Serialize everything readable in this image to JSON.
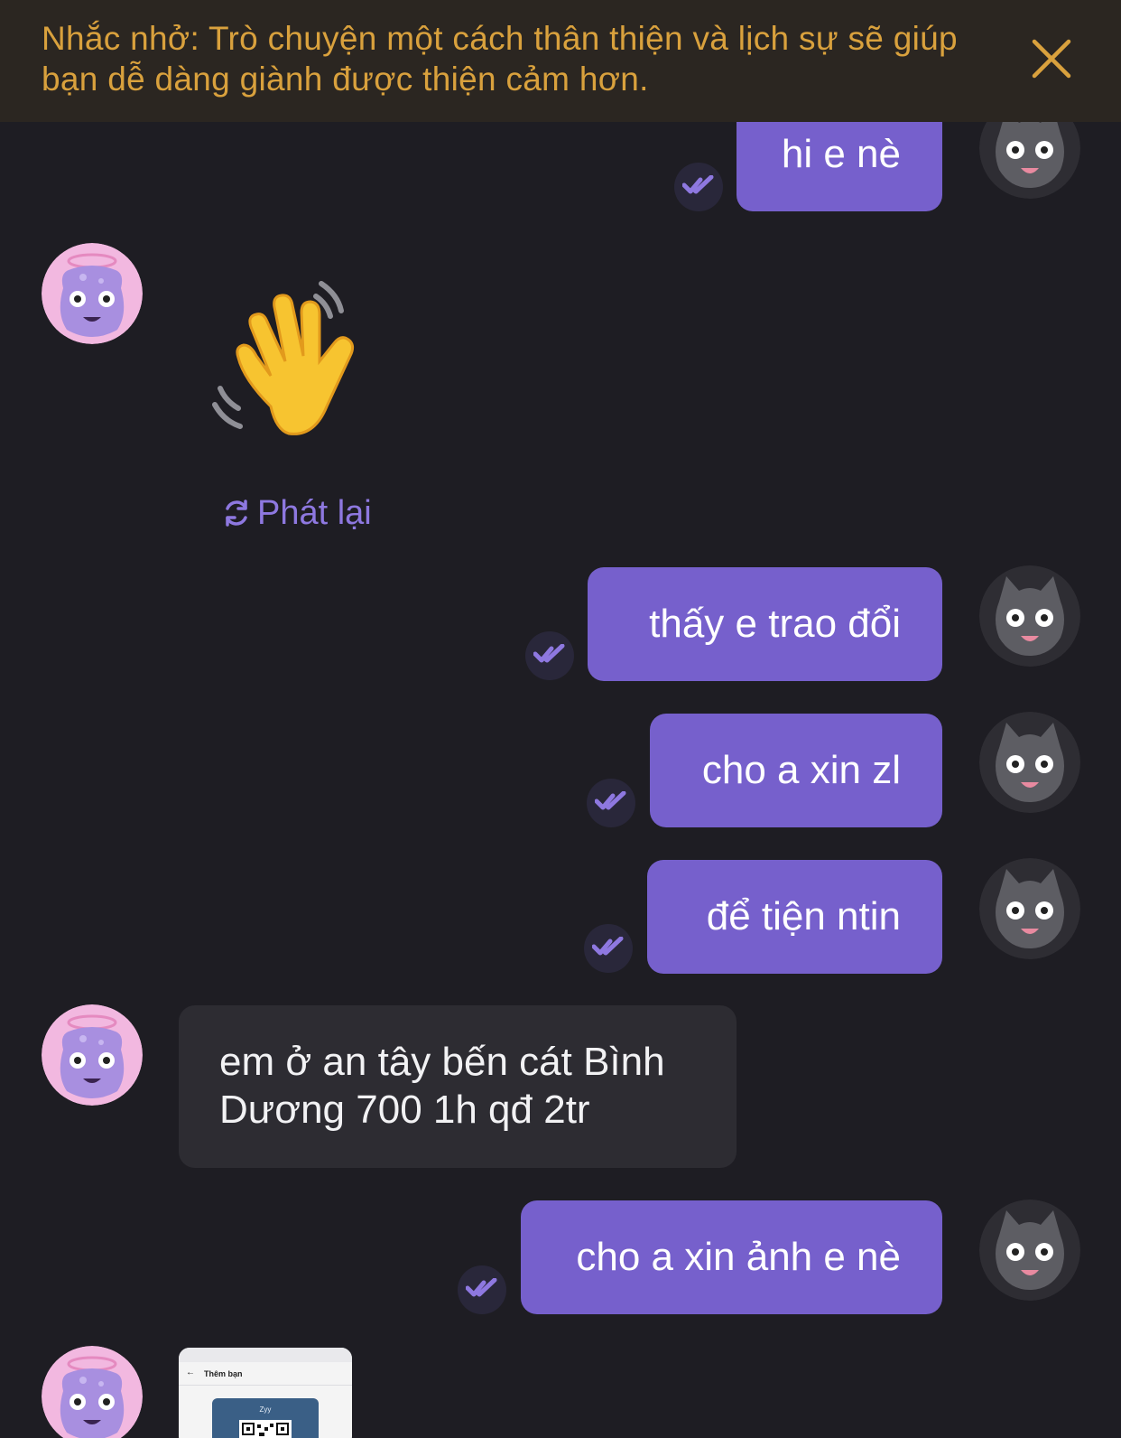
{
  "banner": {
    "text": "Nhắc nhở: Trò chuyện một cách thân thiện và lịch sự sẽ giúp bạn dễ dàng giành được thiện cảm hơn.",
    "close_icon": "close-icon"
  },
  "messages": {
    "m1": {
      "text": "hi e nè",
      "status": "read"
    },
    "m2": {
      "sticker": "waving-hand",
      "replay_label": "Phát lại"
    },
    "m3": {
      "text": "thấy e trao đổi",
      "status": "read"
    },
    "m4": {
      "text": "cho a xin zl",
      "status": "read"
    },
    "m5": {
      "text": "để tiện ntin",
      "status": "read"
    },
    "m6": {
      "line1": "em ở an tây bến cát Bình",
      "line2": "Dương 700 1h qđ 2tr"
    },
    "m7": {
      "text": "cho a xin ảnh e nè",
      "status": "read"
    },
    "m8": {
      "image_title": "Thêm bạn",
      "image_card_name": "Zyy"
    }
  },
  "colors": {
    "background": "#1e1d23",
    "outgoing_bubble": "#7660cc",
    "incoming_bubble": "#2d2c32",
    "banner_bg": "#2b2621",
    "banner_text": "#d9a13d",
    "accent": "#8e78e0"
  },
  "icons": {
    "read_receipt": "double-check-icon",
    "replay": "refresh-icon",
    "self_avatar": "gray-monster-avatar",
    "partner_avatar": "purple-monster-avatar"
  }
}
